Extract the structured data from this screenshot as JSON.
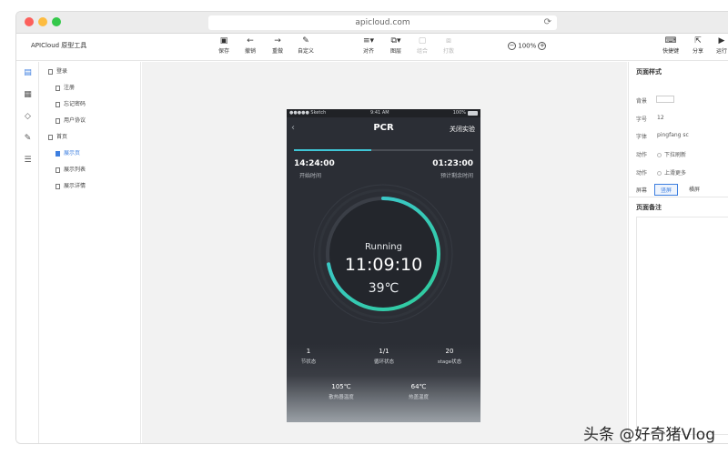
{
  "browser": {
    "url": "apicloud.com",
    "reload_icon": "reload-icon"
  },
  "app": {
    "title": "APICloud 原型工具"
  },
  "toolbar": {
    "save": "保存",
    "undo": "撤销",
    "redo": "重做",
    "custom": "自定义",
    "align": "对齐",
    "layer": "图层",
    "group": "组合",
    "ungroup": "打散",
    "zoom": "100%",
    "shortcut": "快捷键",
    "share": "分享",
    "run": "运行"
  },
  "tree": {
    "login": "登录",
    "register": "注册",
    "forgot": "忘记密码",
    "agreement": "用户协议",
    "home": "首页",
    "show_page": "展示页",
    "show_list": "展示列表",
    "show_detail": "展示详情"
  },
  "phone": {
    "carrier": "●●●●● Sketch",
    "time": "9:41 AM",
    "battery": "100%",
    "title": "PCR",
    "close": "关闭实验",
    "progress_percent": 43,
    "start_time": "14:24:00",
    "start_label": "开始时间",
    "remain_time": "01:23:00",
    "remain_label": "预计剩余时间",
    "status": "Running",
    "elapsed": "11:09:10",
    "temp": "39℃",
    "gauge_fraction": 0.72,
    "stats": [
      {
        "value": "1",
        "label": "节状态"
      },
      {
        "value": "1/1",
        "label": "循环状态"
      },
      {
        "value": "20",
        "label": "stage状态"
      }
    ],
    "temps": [
      {
        "value": "105℃",
        "label": "散热器温度"
      },
      {
        "value": "64℃",
        "label": "热盖温度"
      }
    ]
  },
  "panel": {
    "style_title": "页面样式",
    "bg_label": "背景",
    "font_size_label": "字号",
    "font_size_value": "12",
    "font_label": "字体",
    "font_value": "pingfang sc",
    "action1_label": "动作",
    "action1_value": "下拉刷新",
    "action2_label": "动作",
    "action2_value": "上滑更多",
    "screen_label": "屏幕",
    "portrait": "竖屏",
    "landscape": "横屏",
    "notes_title": "页面备注"
  },
  "watermark": "头条 @好奇猪Vlog",
  "colors": {
    "accent": "#3d7fe0",
    "gauge": "#3fc6d6",
    "gauge_start": "#2ecc9a",
    "phone_bg": "#2b2e35"
  }
}
